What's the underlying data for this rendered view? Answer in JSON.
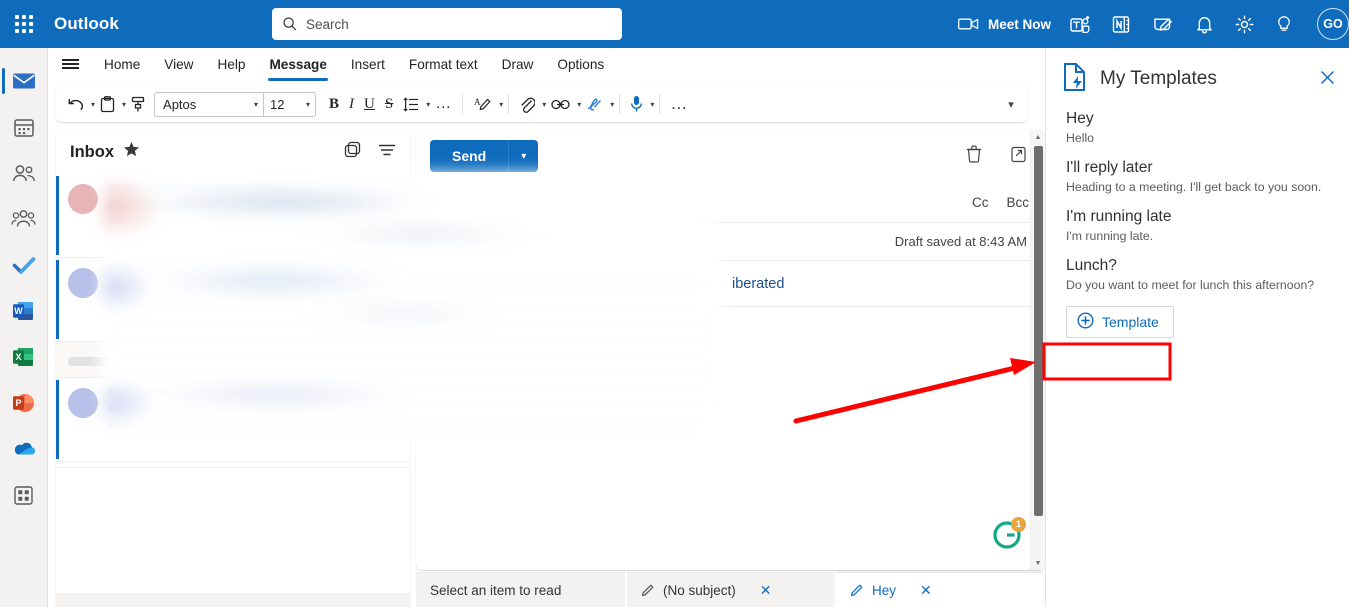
{
  "topbar": {
    "brand": "Outlook",
    "search_placeholder": "Search",
    "meet_now": "Meet Now",
    "avatar_initials": "GO",
    "icons": [
      "camera-icon",
      "teams-icon",
      "onenote-icon",
      "notes-icon",
      "bell-icon",
      "gear-icon",
      "lightbulb-icon"
    ],
    "accent": "#0f6cbd"
  },
  "rail": {
    "items": [
      {
        "name": "mail",
        "selected": true
      },
      {
        "name": "calendar",
        "selected": false
      },
      {
        "name": "people",
        "selected": false
      },
      {
        "name": "groups",
        "selected": false
      },
      {
        "name": "todo",
        "selected": false
      },
      {
        "name": "word",
        "selected": false
      },
      {
        "name": "excel",
        "selected": false
      },
      {
        "name": "powerpoint",
        "selected": false
      },
      {
        "name": "onedrive",
        "selected": false
      },
      {
        "name": "all-apps",
        "selected": false
      }
    ]
  },
  "ribbon": {
    "tabs": [
      {
        "label": "Home",
        "active": false
      },
      {
        "label": "View",
        "active": false
      },
      {
        "label": "Help",
        "active": false
      },
      {
        "label": "Message",
        "active": true
      },
      {
        "label": "Insert",
        "active": false
      },
      {
        "label": "Format text",
        "active": false
      },
      {
        "label": "Draw",
        "active": false
      },
      {
        "label": "Options",
        "active": false
      }
    ]
  },
  "toolbar": {
    "font_name": "Aptos",
    "font_size": "12",
    "bold": "B",
    "italic": "I",
    "underline": "U",
    "strikethrough": "S",
    "more": "…",
    "icons": [
      "undo-icon",
      "paste-icon",
      "format-painter-icon",
      "line-spacing-icon",
      "text-highlight-icon",
      "attach-icon",
      "link-icon",
      "signature-icon",
      "microphone-icon"
    ]
  },
  "list": {
    "title": "Inbox",
    "star_icon": "star-icon",
    "conversation_icon": "conversation-icon",
    "filter_icon": "filter-icon"
  },
  "compose": {
    "send_label": "Send",
    "delete_icon": "trash-icon",
    "popout_icon": "popout-icon",
    "cc": "Cc",
    "bcc": "Bcc",
    "draft_status": "Draft saved at 8:43 AM",
    "subject_fragment": "iberated",
    "grammarly_badge": "1"
  },
  "bottom_tabs": [
    {
      "label": "Select an item to read",
      "active": false,
      "closable": false,
      "icon": null
    },
    {
      "label": "(No subject)",
      "active": false,
      "closable": true,
      "icon": "pencil-icon"
    },
    {
      "label": "Hey",
      "active": true,
      "closable": true,
      "icon": "pencil-icon"
    }
  ],
  "templates_panel": {
    "icon": "template-lightning-icon",
    "title": "My Templates",
    "close_icon": "close-icon",
    "items": [
      {
        "name": "Hey",
        "desc": "Hello"
      },
      {
        "name": "I'll reply later",
        "desc": "Heading to a meeting. I'll get back to you soon."
      },
      {
        "name": "I'm running late",
        "desc": "I'm running late."
      },
      {
        "name": "Lunch?",
        "desc": "Do you want to meet for lunch this afternoon?"
      }
    ],
    "add_button": {
      "label": "Template",
      "icon": "circle-plus-icon"
    }
  },
  "annotations": {
    "highlight_color": "#ff0000",
    "arrow": "points to the Template button"
  }
}
